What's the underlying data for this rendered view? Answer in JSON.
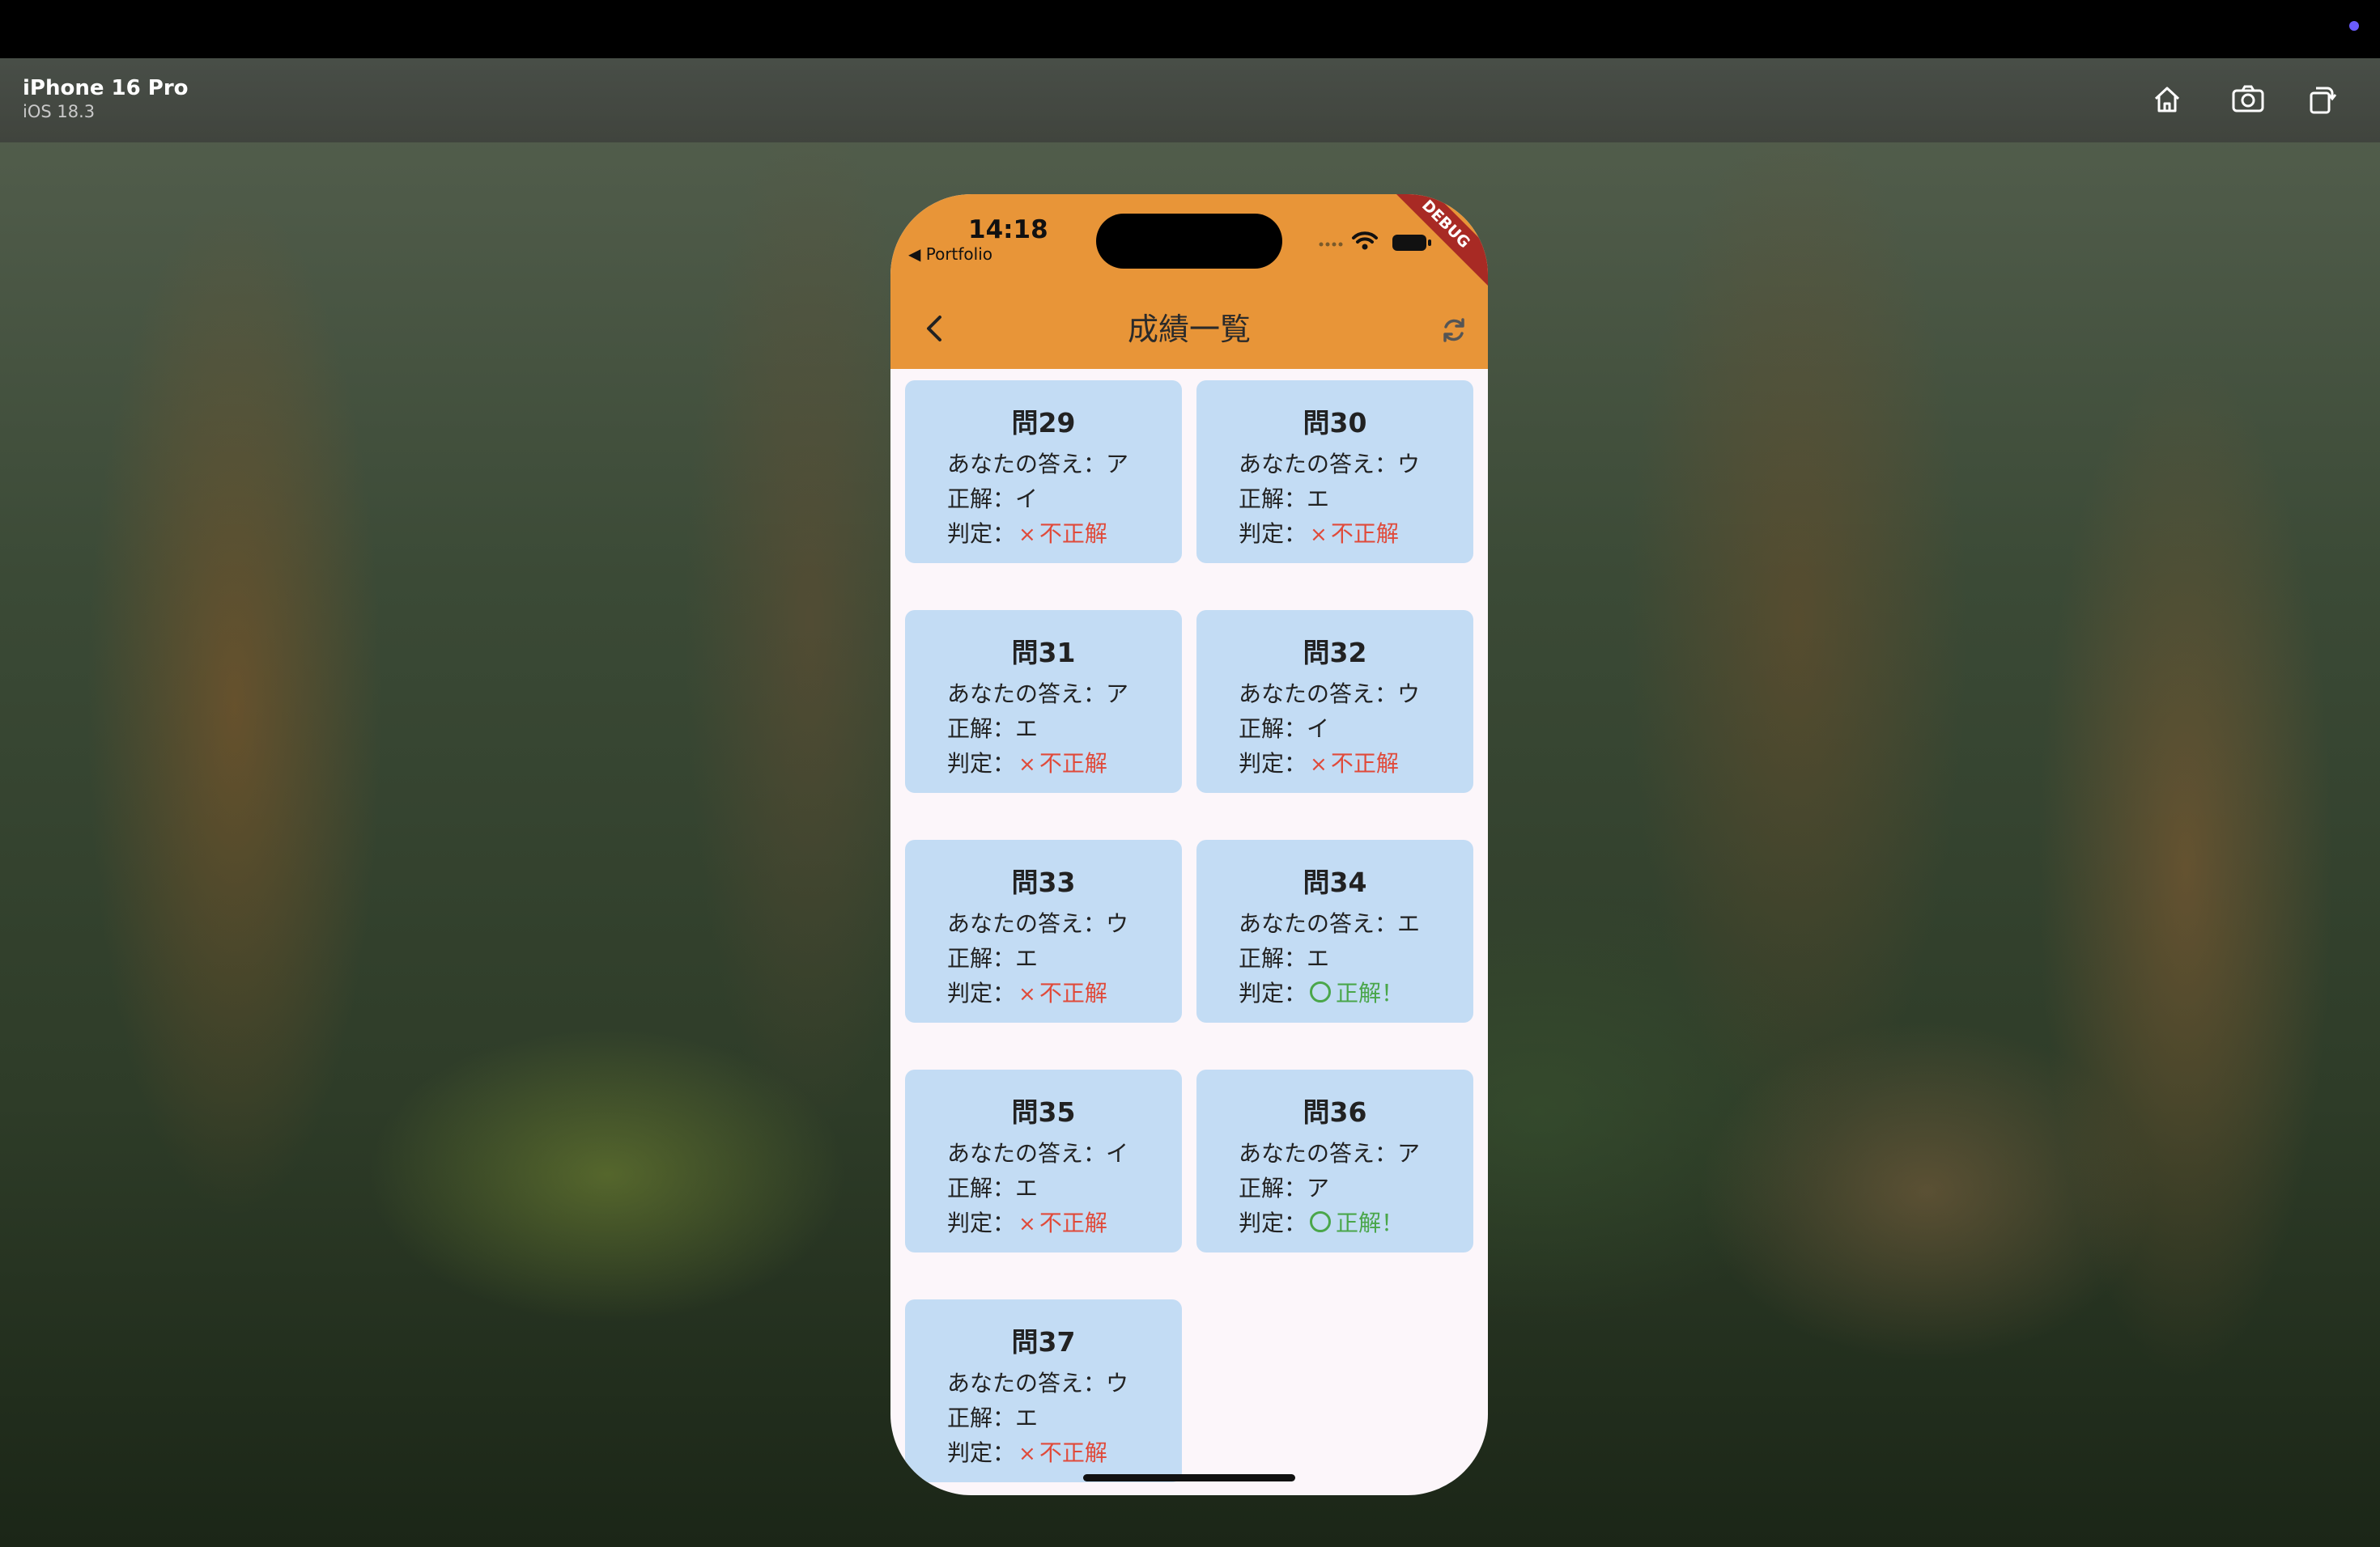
{
  "simulator": {
    "device_name": "iPhone 16 Pro",
    "os_version": "iOS 18.3",
    "buttons": [
      "home-icon",
      "screenshot-icon",
      "rotate-icon"
    ]
  },
  "status_bar": {
    "time": "14:18",
    "back_app": "◀ Portfolio",
    "debug_banner": "DEBUG"
  },
  "app_bar": {
    "title": "成績一覧",
    "back_icon": "chevron-left-icon",
    "refresh_icon": "refresh-icon",
    "color": "#e89538"
  },
  "cards": [
    {
      "q": "問29",
      "yours": "あなたの答え：ア",
      "answer": "正解：イ",
      "verdict_label": "判定：",
      "verdict": "不正解",
      "correct": false
    },
    {
      "q": "問30",
      "yours": "あなたの答え：ウ",
      "answer": "正解：エ",
      "verdict_label": "判定：",
      "verdict": "不正解",
      "correct": false
    },
    {
      "q": "問31",
      "yours": "あなたの答え：ア",
      "answer": "正解：エ",
      "verdict_label": "判定：",
      "verdict": "不正解",
      "correct": false
    },
    {
      "q": "問32",
      "yours": "あなたの答え：ウ",
      "answer": "正解：イ",
      "verdict_label": "判定：",
      "verdict": "不正解",
      "correct": false
    },
    {
      "q": "問33",
      "yours": "あなたの答え：ウ",
      "answer": "正解：エ",
      "verdict_label": "判定：",
      "verdict": "不正解",
      "correct": false
    },
    {
      "q": "問34",
      "yours": "あなたの答え：エ",
      "answer": "正解：エ",
      "verdict_label": "判定：",
      "verdict": "正解！",
      "correct": true
    },
    {
      "q": "問35",
      "yours": "あなたの答え：イ",
      "answer": "正解：エ",
      "verdict_label": "判定：",
      "verdict": "不正解",
      "correct": false
    },
    {
      "q": "問36",
      "yours": "あなたの答え：ア",
      "answer": "正解：ア",
      "verdict_label": "判定：",
      "verdict": "正解！",
      "correct": true
    },
    {
      "q": "問37",
      "yours": "あなたの答え：ウ",
      "answer": "正解：エ",
      "verdict_label": "判定：",
      "verdict": "不正解",
      "correct": false
    }
  ],
  "colors": {
    "card_bg": "#c3dcf4",
    "incorrect": "#e04a3a",
    "correct": "#4aa64a"
  }
}
